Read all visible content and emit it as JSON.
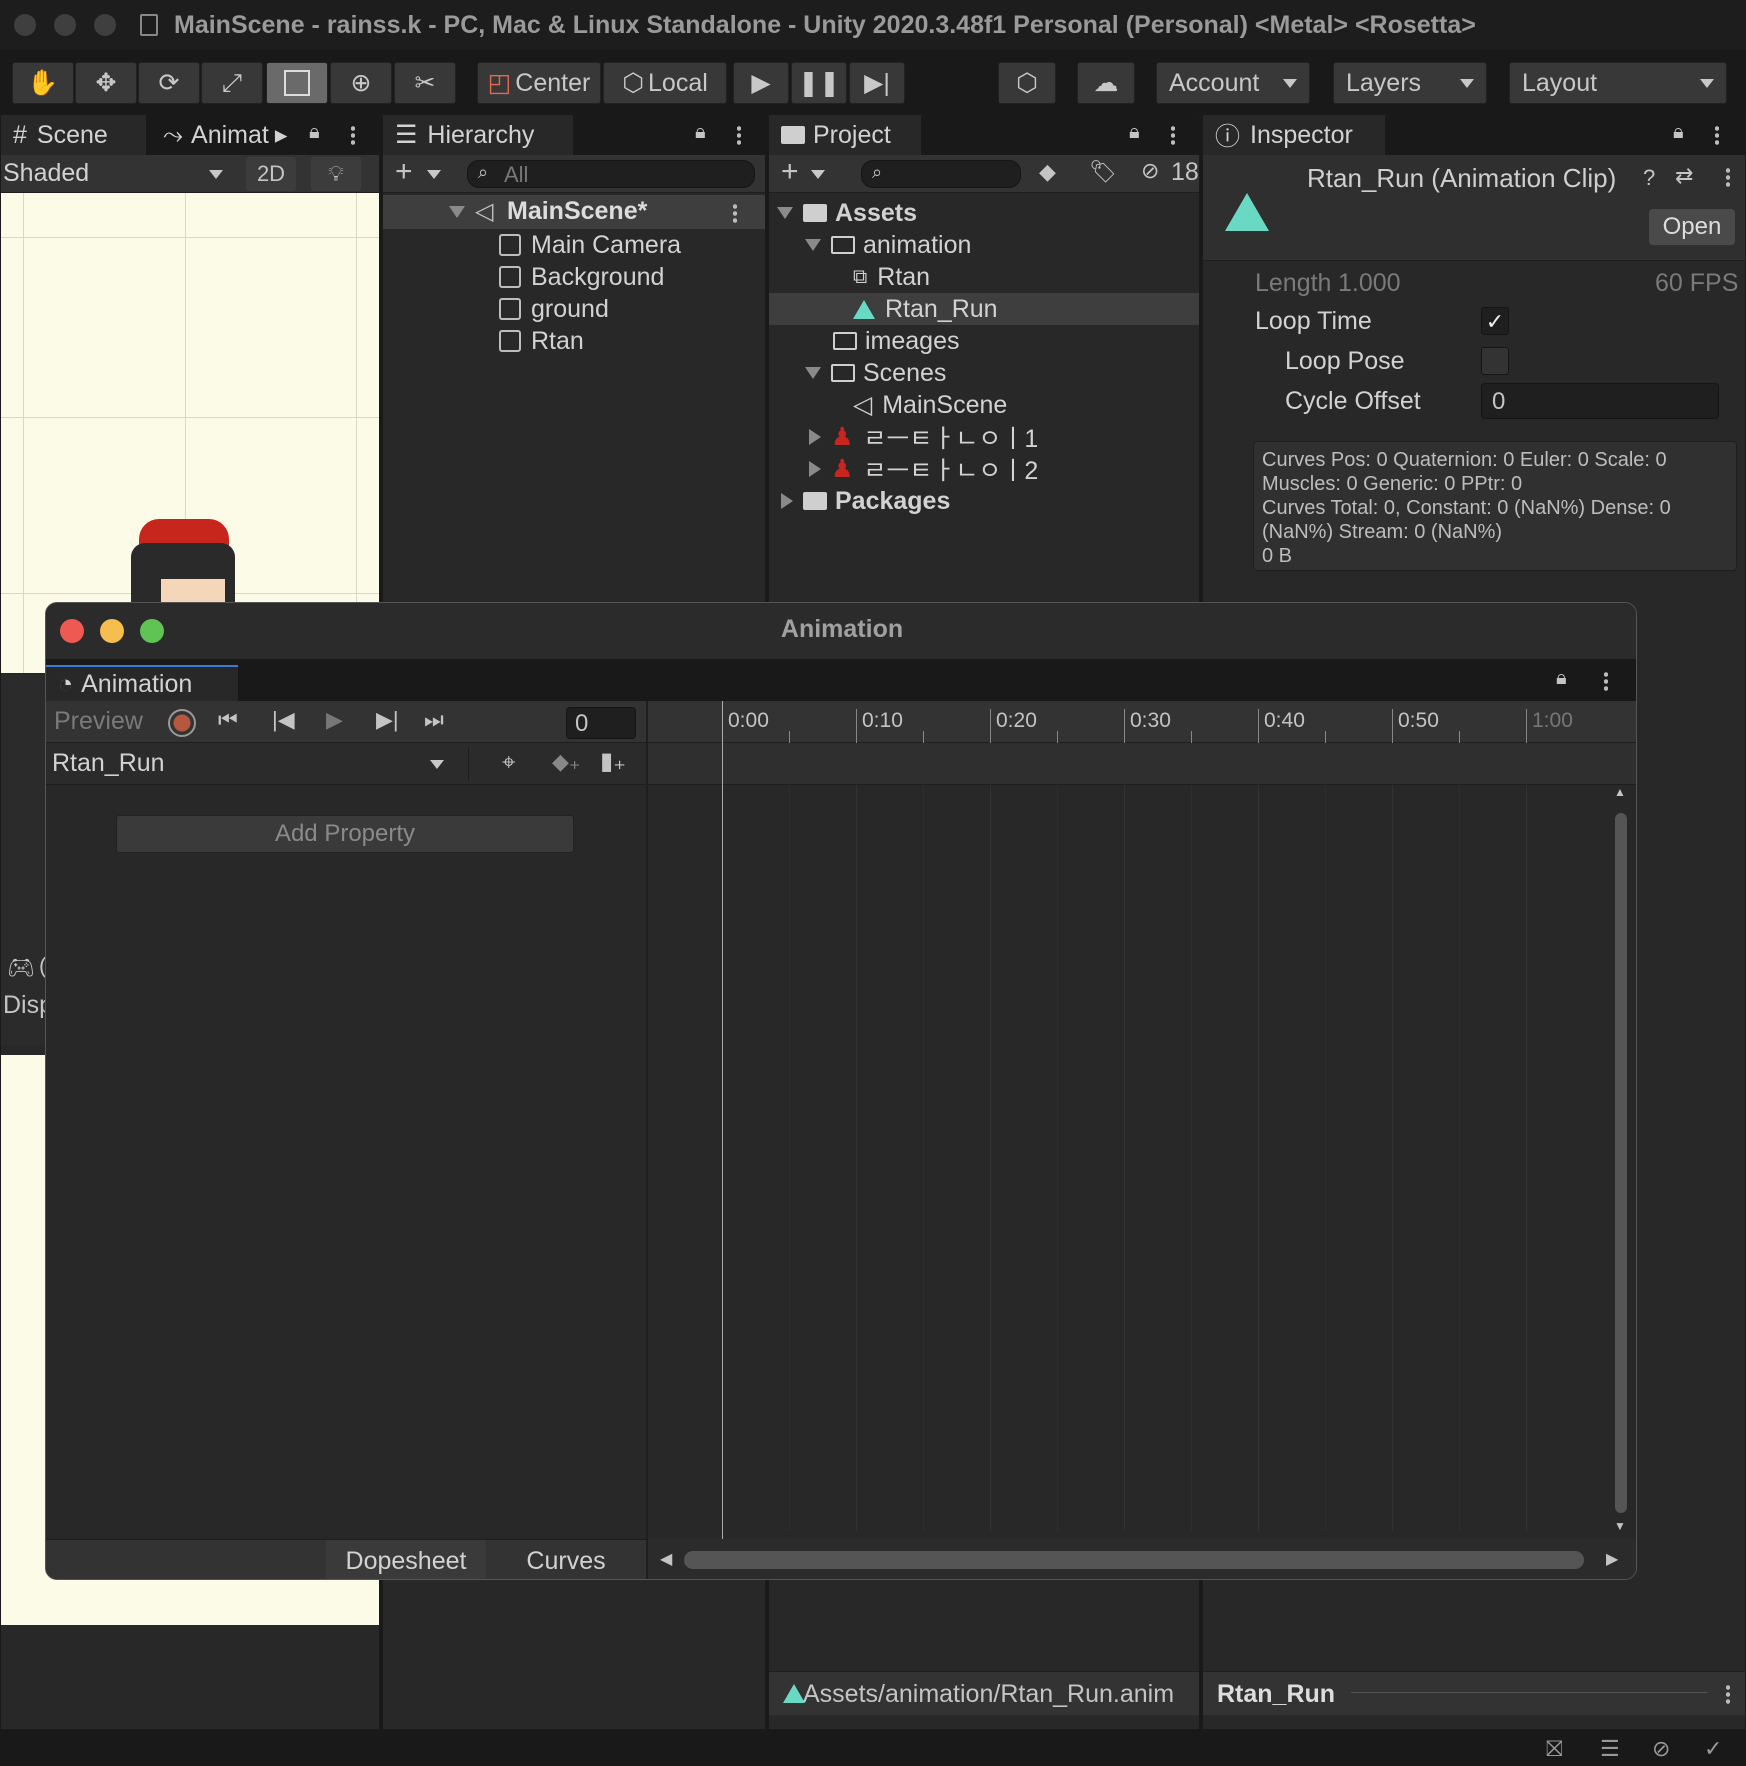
{
  "window_title": "MainScene - rainss.k - PC, Mac & Linux Standalone - Unity 2020.3.48f1 Personal (Personal) <Metal> <Rosetta>",
  "toolbar": {
    "center_label": "Center",
    "local_label": "Local",
    "account_label": "Account",
    "layers_label": "Layers",
    "layout_label": "Layout"
  },
  "scene": {
    "tab_label": "Scene",
    "animator_tab_label": "Animat",
    "shading_mode": "Shaded",
    "mode_2d": "2D",
    "game_tab_label": "(",
    "display_label": "Disp"
  },
  "hierarchy": {
    "tab_label": "Hierarchy",
    "search_placeholder": "All",
    "root": "MainScene*",
    "items": [
      "Main Camera",
      "Background",
      "ground",
      "Rtan"
    ]
  },
  "project": {
    "tab_label": "Project",
    "hidden_count": "18",
    "tree": {
      "assets": "Assets",
      "animation": "animation",
      "rtan": "Rtan",
      "rtan_run": "Rtan_Run",
      "images": "imeages",
      "scenes": "Scenes",
      "mainscene": "MainScene",
      "sprite1": "ㄹㅡㅌㅏㄴㅇㅣ1",
      "sprite2": "ㄹㅡㅌㅏㄴㅇㅣ2",
      "packages": "Packages"
    },
    "footer_path": "Assets/animation/Rtan_Run.anim"
  },
  "inspector": {
    "tab_label": "Inspector",
    "object_title": "Rtan_Run (Animation Clip)",
    "open_label": "Open",
    "length_label": "Length",
    "length_value": "1.000",
    "fps": "60 FPS",
    "loop_time_label": "Loop Time",
    "loop_time_checked": true,
    "loop_pose_label": "Loop Pose",
    "loop_pose_checked": false,
    "cycle_offset_label": "Cycle Offset",
    "cycle_offset_value": "0",
    "info_lines": [
      "Curves Pos: 0 Quaternion: 0 Euler: 0 Scale: 0",
      "Muscles: 0 Generic: 0 PPtr: 0",
      "Curves Total: 0, Constant: 0 (NaN%) Dense: 0",
      "(NaN%) Stream: 0 (NaN%)",
      "0 B"
    ],
    "footer_name": "Rtan_Run"
  },
  "animation_window": {
    "title": "Animation",
    "tab_label": "Animation",
    "preview_label": "Preview",
    "frame_value": "0",
    "clip_name": "Rtan_Run",
    "add_property_label": "Add Property",
    "dopesheet_label": "Dopesheet",
    "curves_label": "Curves",
    "timeline_labels": [
      "0:00",
      "0:10",
      "0:20",
      "0:30",
      "0:40",
      "0:50",
      "1:00"
    ]
  },
  "colors": {
    "accent_teal": "#69d9c3",
    "record_red": "#b5583f",
    "close_red": "#ee5a52",
    "minimize_yellow": "#f5be4f",
    "zoom_green": "#5fc454"
  }
}
